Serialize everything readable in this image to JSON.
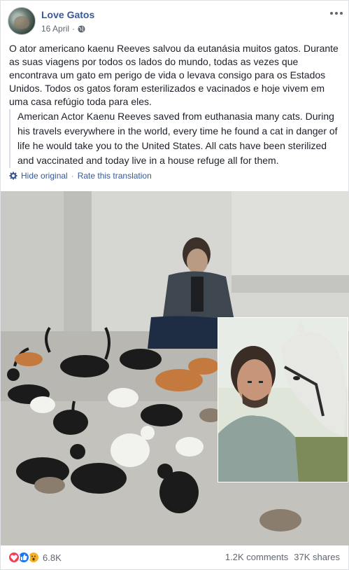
{
  "post": {
    "page_name": "Love Gatos",
    "date": "16 April",
    "date_separator": "·",
    "audience_icon": "globe-icon",
    "more_icon": "more-options-icon",
    "original_text": "O ator americano kaenu Reeves salvou da eutanásia muitos gatos. Durante as suas viagens por todos os lados do mundo, todas as vezes que encontrava um gato em perigo de vida o levava consigo para os Estados Unidos. Todos os gatos foram esterilizados e vacinados e hoje vivem em uma casa refúgio toda para eles.",
    "translation_text": "American Actor Kaenu Reeves saved from euthanasia many cats. During his travels everywhere in the world, every time he found a cat in danger of life he would take you to the United States. All cats have been sterilized and vaccinated and today live in a house refuge all for them.",
    "hide_original_label": "Hide original",
    "action_separator": "·",
    "rate_translation_label": "Rate this translation"
  },
  "footer": {
    "reaction_icons": [
      "love-icon",
      "like-icon",
      "wow-icon"
    ],
    "reaction_count": "6.8K",
    "comments": "1.2K comments",
    "shares": "37K shares"
  },
  "colors": {
    "link": "#385898",
    "meta": "#616770",
    "love": "#f33e58",
    "like": "#1877f2",
    "wow": "#f7b125"
  }
}
